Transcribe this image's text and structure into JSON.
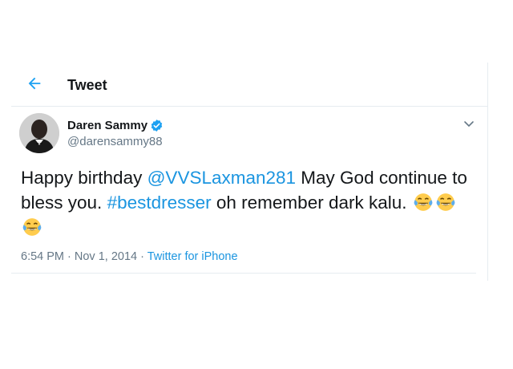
{
  "header": {
    "title": "Tweet",
    "back_icon": "arrow-left-icon"
  },
  "tweet": {
    "author_name": "Daren Sammy",
    "author_handle": "@darensammy88",
    "verified_icon": "verified-badge-icon",
    "more_icon": "chevron-down-icon",
    "text_parts": {
      "p1": "Happy birthday ",
      "mention": "@VVSLaxman281",
      "p2": " May God continue to bless you. ",
      "hashtag": "#bestdresser",
      "p3": " oh remember dark kalu. "
    },
    "emoji_icon": "face-with-tears-of-joy-icon",
    "time": "6:54 PM",
    "separator": " · ",
    "date": "Nov 1, 2014",
    "source": "Twitter for iPhone"
  },
  "colors": {
    "link": "#1b95e0",
    "verified": "#1da1f2",
    "secondary_text": "#657786",
    "border": "#e6ecf0"
  }
}
